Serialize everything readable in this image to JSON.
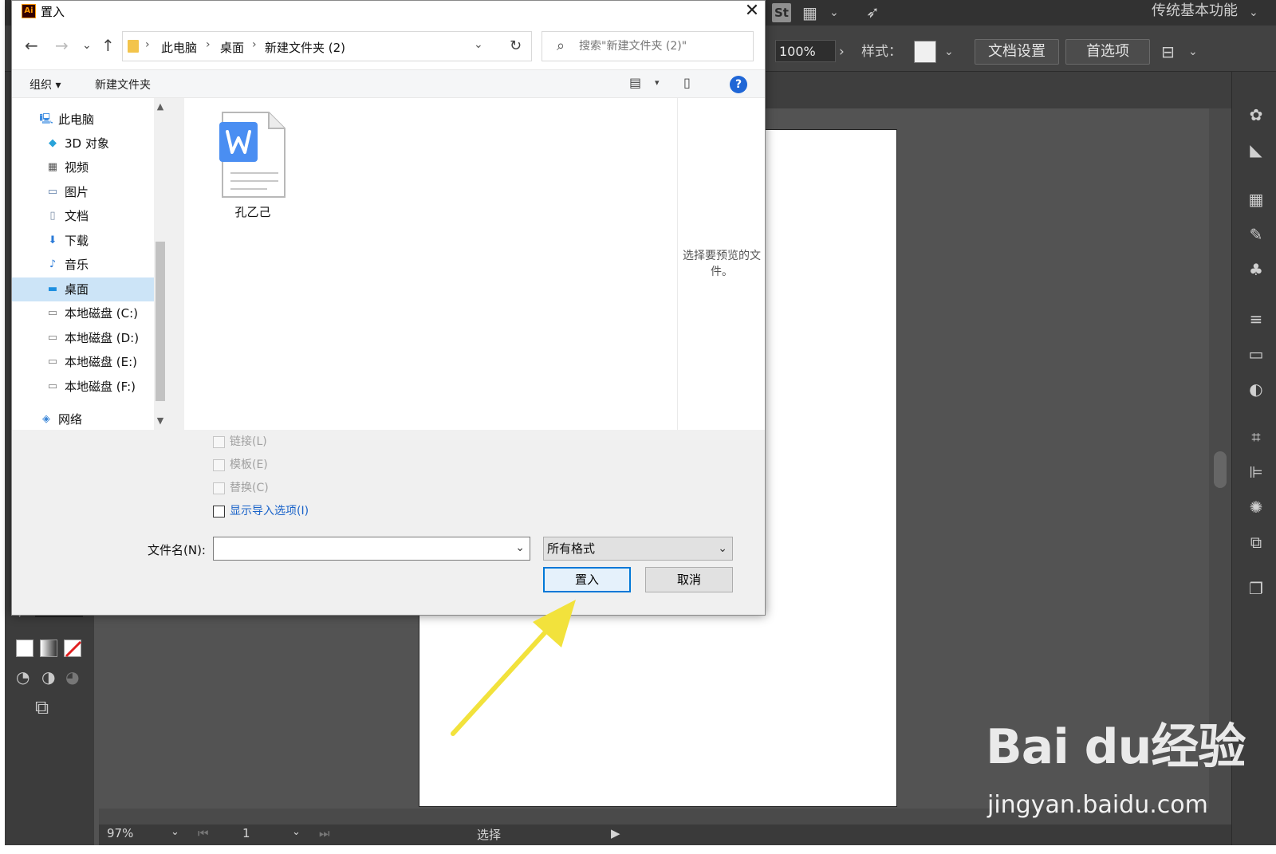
{
  "dialog": {
    "title": "置入",
    "close_glyph": "✕",
    "address": {
      "back": "←",
      "forward": "→",
      "recent": "⌄",
      "up": "↑",
      "crumbs": [
        "此电脑",
        "桌面",
        "新建文件夹 (2)"
      ],
      "refresh": "↻"
    },
    "search": {
      "placeholder": "搜索\"新建文件夹 (2)\""
    },
    "commands": {
      "organize": "组织 ▾",
      "new_folder": "新建文件夹"
    },
    "nav_items": [
      {
        "label": "此电脑",
        "icon": "computer-icon"
      },
      {
        "label": "3D 对象",
        "icon": "cube-icon"
      },
      {
        "label": "视频",
        "icon": "video-icon"
      },
      {
        "label": "图片",
        "icon": "picture-icon"
      },
      {
        "label": "文档",
        "icon": "document-icon"
      },
      {
        "label": "下载",
        "icon": "download-icon"
      },
      {
        "label": "音乐",
        "icon": "music-icon"
      },
      {
        "label": "桌面",
        "icon": "desktop-icon",
        "selected": true
      },
      {
        "label": "本地磁盘 (C:)",
        "icon": "drive-icon"
      },
      {
        "label": "本地磁盘 (D:)",
        "icon": "drive-icon"
      },
      {
        "label": "本地磁盘 (E:)",
        "icon": "drive-icon"
      },
      {
        "label": "本地磁盘 (F:)",
        "icon": "drive-icon"
      },
      {
        "label": "网络",
        "icon": "network-icon"
      }
    ],
    "files": [
      {
        "name": "孔乙己",
        "icon": "word-document-icon"
      }
    ],
    "preview_message": "选择要预览的文件。",
    "options": [
      {
        "label": "链接(L)",
        "enabled": false
      },
      {
        "label": "模板(E)",
        "enabled": false
      },
      {
        "label": "替换(C)",
        "enabled": false
      },
      {
        "label": "显示导入选项(I)",
        "enabled": true
      }
    ],
    "filename_label": "文件名(N):",
    "filename_value": "",
    "filetype": "所有格式",
    "place_button": "置入",
    "cancel_button": "取消"
  },
  "illustrator": {
    "st_badge": "St",
    "workspace": "传统基本功能",
    "zoom_control": "100%",
    "style_label": "样式：",
    "doc_setup": "文档设置",
    "preferences": "首选项",
    "status_zoom": "97%",
    "artboard_number": "1",
    "status_tool": "选择"
  },
  "watermark": {
    "logo": "Bai du经验",
    "url": "jingyan.baidu.com"
  },
  "colors": {
    "accent_blue": "#0078d7",
    "arrow_yellow": "#f2e23c",
    "word_blue": "#4a8ef2",
    "ai_background": "#535353"
  }
}
